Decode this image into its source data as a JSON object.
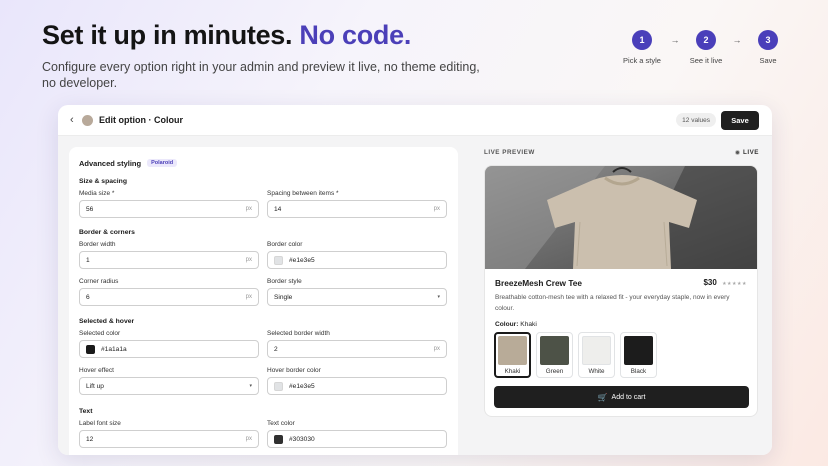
{
  "hero": {
    "title_main": "Set it up in minutes.",
    "title_accent": "No code.",
    "subtitle": "Configure every option right in your admin and preview it live, no theme editing, no developer."
  },
  "steps": [
    {
      "number": "1",
      "label": "Pick a style"
    },
    {
      "number": "2",
      "label": "See it live"
    },
    {
      "number": "3",
      "label": "Save"
    }
  ],
  "step_arrow": "→",
  "editor": {
    "back_icon": "‹",
    "title": "Edit option · Colour",
    "values_count": "12 values",
    "save_label": "Save"
  },
  "form": {
    "title": "Advanced styling",
    "badge": "Polaroid",
    "size_section": "Size & spacing",
    "media_size": {
      "label": "Media size *",
      "value": "56",
      "unit": "px"
    },
    "spacing": {
      "label": "Spacing between items *",
      "value": "14",
      "unit": "px"
    },
    "border_section": "Border & corners",
    "border_width": {
      "label": "Border width",
      "value": "1",
      "unit": "px"
    },
    "border_color": {
      "label": "Border color",
      "value": "#e1e3e5"
    },
    "corner_radius": {
      "label": "Corner radius",
      "value": "6",
      "unit": "px"
    },
    "border_style": {
      "label": "Border style",
      "value": "Single"
    },
    "selected_section": "Selected & hover",
    "selected_color": {
      "label": "Selected color",
      "value": "#1a1a1a"
    },
    "selected_border_width": {
      "label": "Selected border width",
      "value": "2",
      "unit": "px"
    },
    "hover_effect": {
      "label": "Hover effect",
      "value": "Lift up"
    },
    "hover_border_color": {
      "label": "Hover border color",
      "value": "#e1e3e5"
    },
    "text_section": "Text",
    "label_font_size": {
      "label": "Label font size",
      "value": "12",
      "unit": "px"
    },
    "text_color": {
      "label": "Text color",
      "value": "#303030"
    },
    "caret": "▾"
  },
  "preview": {
    "label": "LIVE PREVIEW",
    "live": "LIVE",
    "product_name": "BreezeMesh Crew Tee",
    "price": "$30",
    "stars": "★★★★★",
    "description": "Breathable cotton-mesh tee with a relaxed fit - your everyday staple, now in every colour.",
    "colour_label": "Colour:",
    "colour_value": "Khaki",
    "variants": [
      {
        "name": "Khaki",
        "color": "#b8ab98"
      },
      {
        "name": "Green",
        "color": "#4d5247"
      },
      {
        "name": "White",
        "color": "#eeeeec"
      },
      {
        "name": "Black",
        "color": "#1c1c1c"
      }
    ],
    "cart_label": "Add to cart",
    "cart_icon": "🛒"
  },
  "colors": {
    "accent": "#4b3fb8",
    "step_circle": "#4a3fba",
    "button_dark": "#1f1f1f"
  }
}
